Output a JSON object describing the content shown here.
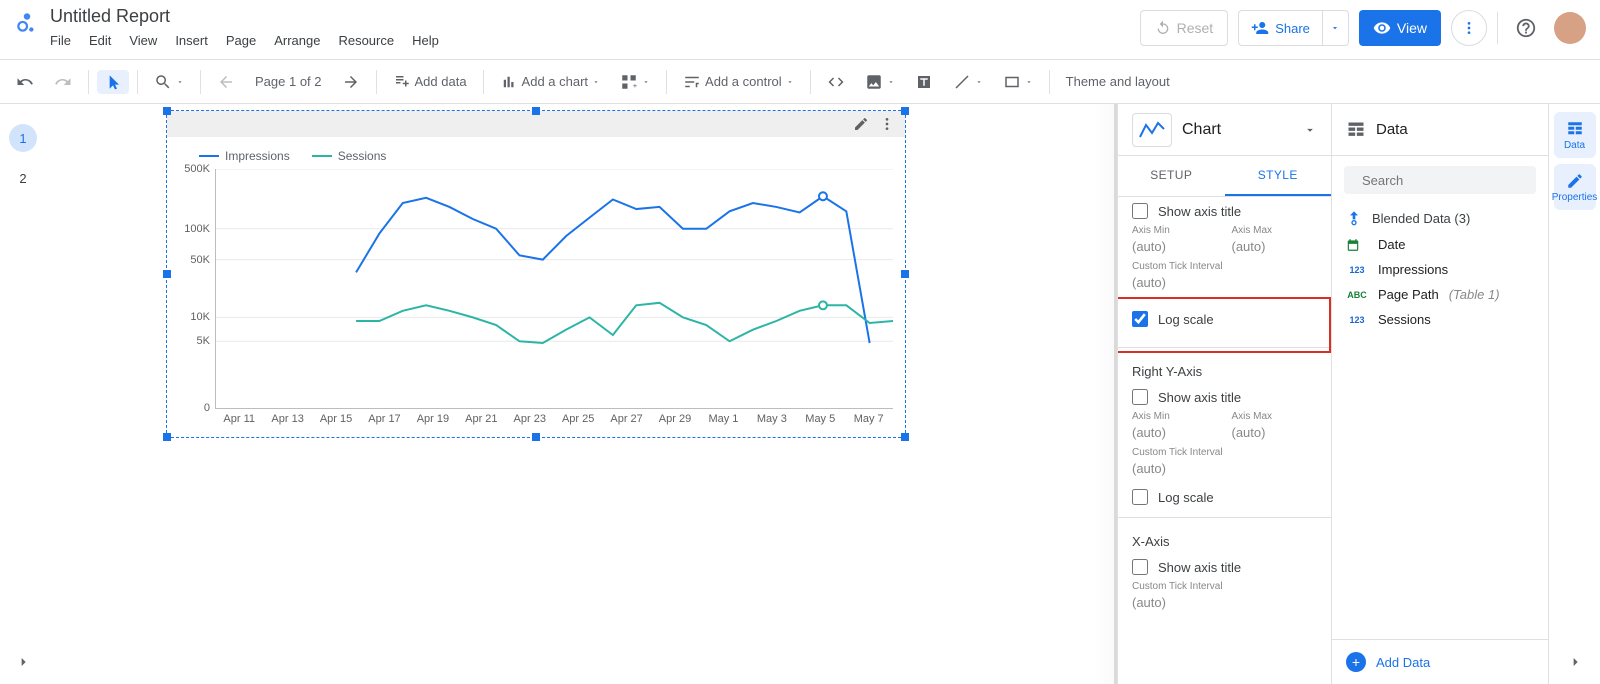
{
  "header": {
    "title": "Untitled Report",
    "menus": [
      "File",
      "Edit",
      "View",
      "Insert",
      "Page",
      "Arrange",
      "Resource",
      "Help"
    ],
    "reset": "Reset",
    "share": "Share",
    "view": "View"
  },
  "toolbar": {
    "page_label": "Page 1 of 2",
    "add_data": "Add data",
    "add_chart": "Add a chart",
    "add_control": "Add a control",
    "theme": "Theme and layout"
  },
  "pages": {
    "items": [
      "1",
      "2"
    ],
    "active": 0
  },
  "chart_panel": {
    "title": "Chart",
    "tabs": {
      "setup": "SETUP",
      "style": "STYLE"
    },
    "show_axis_title": "Show axis title",
    "axis_min": "Axis Min",
    "axis_max": "Axis Max",
    "auto": "(auto)",
    "cti": "Custom Tick Interval",
    "log_scale": "Log scale",
    "right_y": "Right Y-Axis",
    "x_axis": "X-Axis"
  },
  "data_panel": {
    "title": "Data",
    "search_placeholder": "Search",
    "source": "Blended Data (3)",
    "fields": [
      {
        "type": "date",
        "label": "Date"
      },
      {
        "type": "num",
        "label": "Impressions"
      },
      {
        "type": "text",
        "label": "Page Path",
        "suffix": "(Table 1)"
      },
      {
        "type": "num",
        "label": "Sessions"
      }
    ],
    "add": "Add Data"
  },
  "rail": {
    "data": "Data",
    "properties": "Properties"
  },
  "chart_data": {
    "type": "line",
    "title": "",
    "xlabel": "",
    "ylabel": "",
    "y_scale": "log",
    "ylim": [
      0,
      500000
    ],
    "y_ticks": [
      0,
      "5K",
      "10K",
      "50K",
      "100K",
      "500K"
    ],
    "categories": [
      "Apr 11",
      "Apr 13",
      "Apr 15",
      "Apr 17",
      "Apr 19",
      "Apr 21",
      "Apr 23",
      "Apr 25",
      "Apr 27",
      "Apr 29",
      "May 1",
      "May 3",
      "May 5",
      "May 7"
    ],
    "legend": [
      "Impressions",
      "Sessions"
    ],
    "colors": {
      "Impressions": "#1a73e8",
      "Sessions": "#2cb5a6"
    },
    "series": [
      {
        "name": "Impressions",
        "values": [
          null,
          null,
          null,
          null,
          null,
          null,
          35000,
          90000,
          200000,
          230000,
          180000,
          130000,
          100000,
          55000,
          50000,
          85000,
          135000,
          220000,
          170000,
          180000,
          100000,
          100000,
          160000,
          200000,
          180000,
          155000,
          240000,
          160000,
          4000,
          null
        ]
      },
      {
        "name": "Sessions",
        "values": [
          null,
          null,
          null,
          null,
          null,
          null,
          9000,
          9000,
          12000,
          14000,
          12000,
          10000,
          8000,
          5000,
          4000,
          7000,
          10000,
          6000,
          14000,
          15000,
          10000,
          8000,
          5000,
          7000,
          9000,
          12000,
          14000,
          14000,
          8500,
          9000
        ]
      }
    ],
    "highlight_x_index": 26
  }
}
